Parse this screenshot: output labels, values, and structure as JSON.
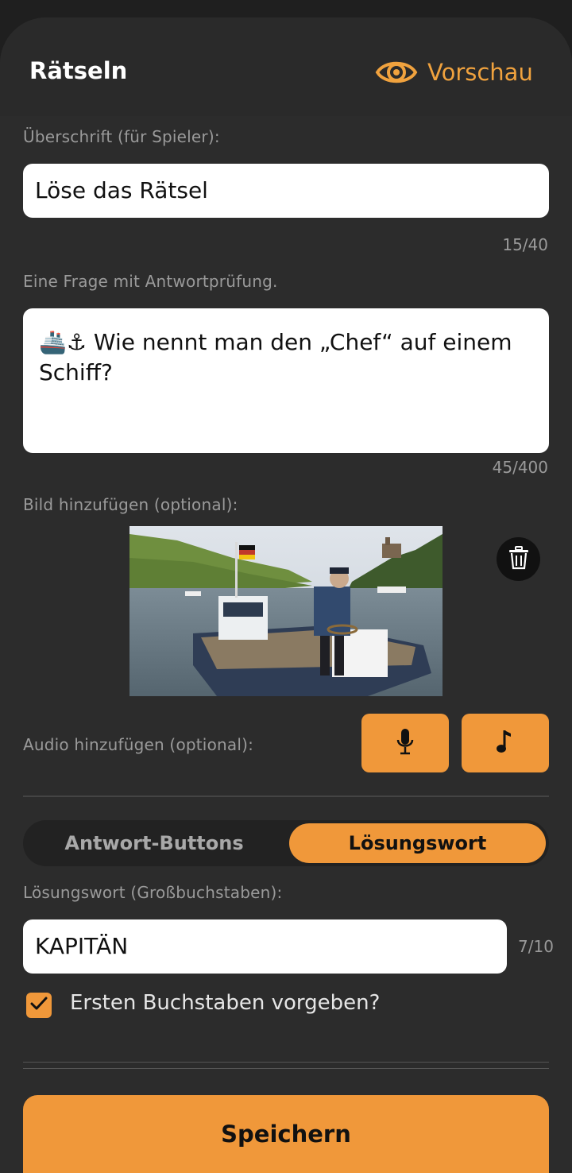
{
  "header": {
    "title": "Rätseln",
    "preview_label": "Vorschau",
    "preview_icon": "eye-icon",
    "accent_color": "#f0a23e"
  },
  "heading_section": {
    "label": "Überschrift (für Spieler):",
    "value": "Löse das Rätsel",
    "counter": "15/40"
  },
  "question_section": {
    "label": "Eine Frage mit Antwortprüfung.",
    "emoji": "🚢⚓",
    "value": "Wie nennt man den „Chef“ auf einem Schiff?",
    "counter": "45/400"
  },
  "image_section": {
    "label": "Bild hinzufügen (optional):",
    "delete_icon": "trash-icon"
  },
  "audio_section": {
    "label": "Audio hinzufügen (optional):",
    "buttons": [
      {
        "icon": "microphone-icon"
      },
      {
        "icon": "music-note-icon"
      }
    ]
  },
  "mode_toggle": {
    "options": [
      "Antwort-Buttons",
      "Lösungswort"
    ],
    "selected": "Lösungswort"
  },
  "solution_section": {
    "label": "Lösungswort (Großbuchstaben):",
    "value": "KAPITÄN",
    "counter": "7/10"
  },
  "first_letter": {
    "label": "Ersten Buchstaben vorgeben?",
    "checked": true
  },
  "save_label": "Speichern",
  "colors": {
    "background": "#2c2c2c",
    "accent": "#f0983a",
    "field": "#ffffff"
  }
}
